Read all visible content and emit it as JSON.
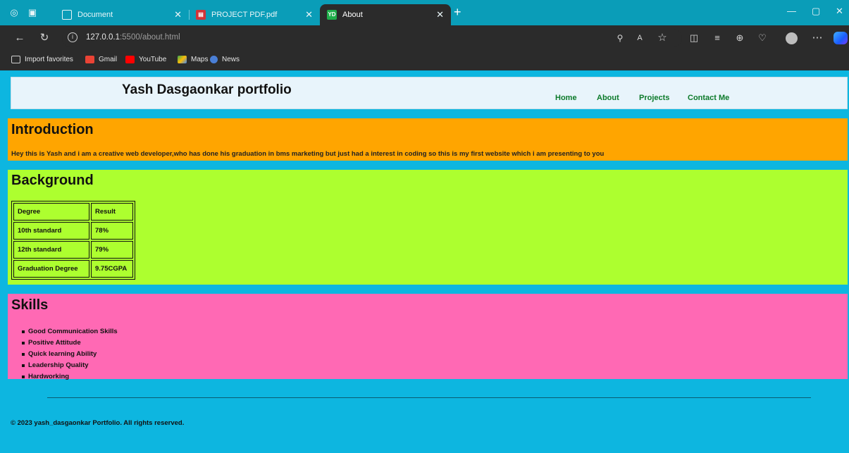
{
  "browser": {
    "tabs": [
      {
        "title": "Document"
      },
      {
        "title": "PROJECT PDF.pdf"
      },
      {
        "title": "About",
        "favicon_text": "YD"
      }
    ],
    "address": {
      "host": "127.0.0.1",
      "rest": ":5500/about.html"
    },
    "favorites": [
      {
        "label": "Import favorites"
      },
      {
        "label": "Gmail"
      },
      {
        "label": "YouTube"
      },
      {
        "label": "Maps"
      },
      {
        "label": "News"
      }
    ],
    "accent_color": "#0a9db8"
  },
  "page": {
    "site_title": "Yash Dasgaonkar portfolio",
    "nav": [
      "Home",
      "About",
      "Projects",
      "Contact Me"
    ],
    "intro": {
      "title": "Introduction",
      "text": "Hey this is Yash and i am a creative web developer,who has done his graduation in bms marketing but just had a interest in coding so this is my first website which i am presenting to you"
    },
    "background": {
      "title": "Background",
      "table": [
        [
          "Degree",
          "Result"
        ],
        [
          "10th standard",
          "78%"
        ],
        [
          "12th standard",
          "79%"
        ],
        [
          "Graduation Degree",
          "9.75CGPA"
        ]
      ]
    },
    "skills": {
      "title": "Skills",
      "items": [
        "Good Communication Skills",
        "Positive Attitude",
        "Quick learning Ability",
        "Leadership Quality",
        "Hardworking"
      ]
    },
    "footer": "© 2023 yash_dasgaonkar Portfolio. All rights reserved.",
    "colors": {
      "page_bg": "#0db6e0",
      "intro_bg": "#ffa500",
      "background_bg": "#adff2f",
      "skills_bg": "#ff69b4",
      "nav_text": "#0c7a2a"
    }
  }
}
